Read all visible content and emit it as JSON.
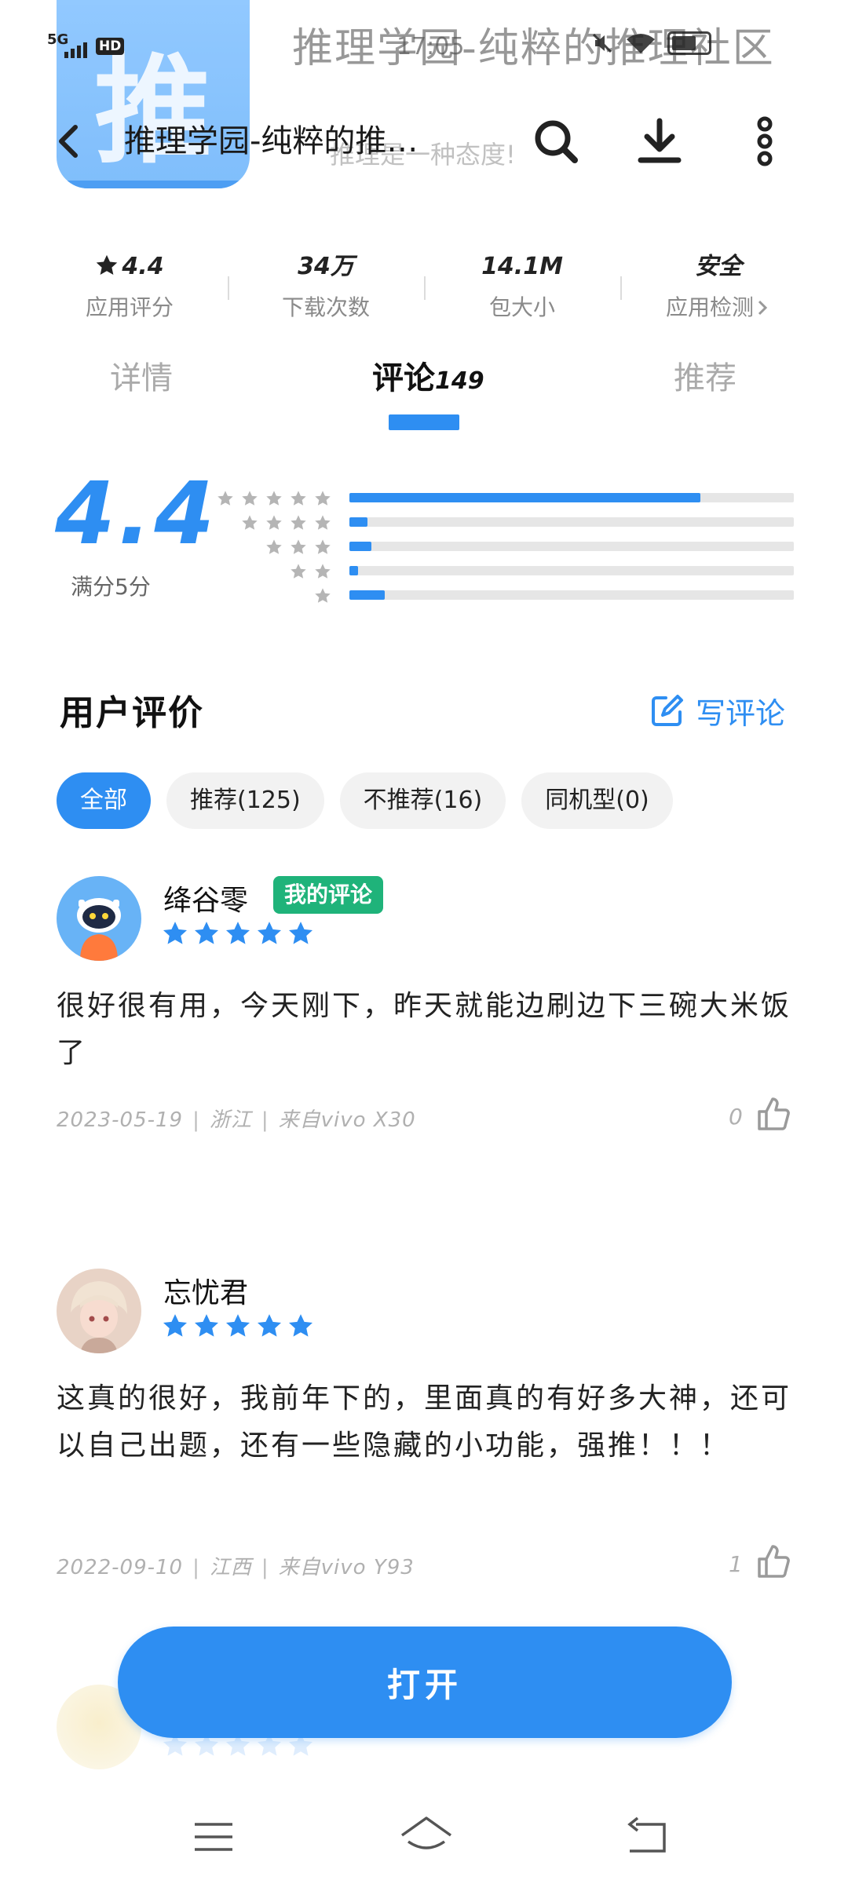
{
  "status_bar": {
    "network": "5G",
    "hd": "HD",
    "time": "17:05"
  },
  "background_header": {
    "app_icon_glyph": "推",
    "title": "推理学园-纯粹的推理社区",
    "slogan": "推理是一种态度!"
  },
  "toolbar": {
    "title": "推理学园-纯粹的推…",
    "icons": [
      "back-icon",
      "search-icon",
      "download-icon",
      "more-icon"
    ]
  },
  "stats": [
    {
      "value": "4.4",
      "label": "应用评分"
    },
    {
      "value": "34万",
      "label": "下载次数"
    },
    {
      "value": "14.1M",
      "label": "包大小"
    },
    {
      "value": "安全",
      "label": "应用检测"
    }
  ],
  "tabs": {
    "details": "详情",
    "reviews": "评论",
    "reviews_count": "149",
    "recommend": "推荐"
  },
  "rating": {
    "score": "4.4",
    "subtitle": "满分5分",
    "distribution": [
      {
        "stars": 5,
        "fraction": 0.79
      },
      {
        "stars": 4,
        "fraction": 0.04
      },
      {
        "stars": 3,
        "fraction": 0.05
      },
      {
        "stars": 2,
        "fraction": 0.02
      },
      {
        "stars": 1,
        "fraction": 0.08
      }
    ]
  },
  "reviews_section": {
    "title": "用户评价",
    "write_label": "写评论",
    "filters": [
      "全部",
      "推荐(125)",
      "不推荐(16)",
      "同机型(0)"
    ],
    "active_filter": 0
  },
  "reviews": [
    {
      "name": "绛谷零",
      "badge": "我的评论",
      "stars": 5,
      "text": "很好很有用，今天刚下，昨天就能边刷边下三碗大米饭了",
      "date": "2023-05-19",
      "region": "浙江",
      "device": "来自vivo X30",
      "likes": "0"
    },
    {
      "name": "忘忧君",
      "stars": 5,
      "text": "这真的很好，我前年下的，里面真的有好多大神，还可以自己出题，还有一些隐藏的小功能，强推！！！",
      "date": "2022-09-10",
      "region": "江西",
      "device": "来自vivo Y93",
      "likes": "1"
    }
  ],
  "cta": {
    "open_label": "打开"
  },
  "colors": {
    "accent": "#2e8ef2",
    "badge_green": "#1fb37a",
    "track_gray": "#e6e6e6"
  }
}
